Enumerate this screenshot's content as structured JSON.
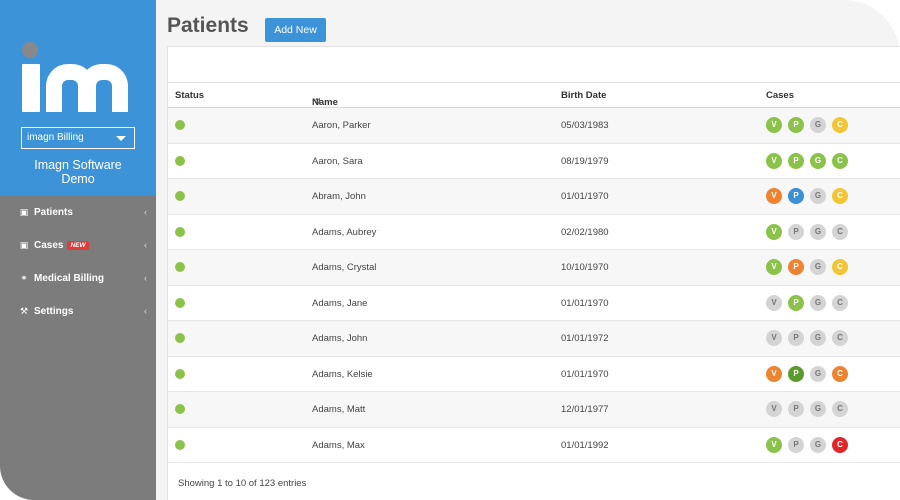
{
  "sidebar": {
    "client_select": "imagn Billing",
    "org_name_line1": "Imagn Software",
    "org_name_line2": "Demo",
    "nav": [
      {
        "label": "Patients",
        "icon": "briefcase-icon",
        "badge": ""
      },
      {
        "label": "Cases",
        "icon": "briefcase-icon",
        "badge": "NEW"
      },
      {
        "label": "Medical Billing",
        "icon": "stethoscope-icon",
        "badge": ""
      },
      {
        "label": "Settings",
        "icon": "wrench-icon",
        "badge": ""
      }
    ]
  },
  "main": {
    "title": "Patients",
    "add_label": "Add New",
    "columns": {
      "status": "Status",
      "name": "Name",
      "birth": "Birth Date",
      "cases": "Cases"
    },
    "rows": [
      {
        "name": "Aaron, Parker",
        "birth": "05/03/1983",
        "cases": [
          "green",
          "green",
          "grey",
          "yellow"
        ]
      },
      {
        "name": "Aaron, Sara",
        "birth": "08/19/1979",
        "cases": [
          "green",
          "green",
          "green",
          "green"
        ]
      },
      {
        "name": "Abram, John",
        "birth": "01/01/1970",
        "cases": [
          "orange",
          "blue",
          "grey",
          "yellow"
        ]
      },
      {
        "name": "Adams, Aubrey",
        "birth": "02/02/1980",
        "cases": [
          "green",
          "grey",
          "grey",
          "grey"
        ]
      },
      {
        "name": "Adams, Crystal",
        "birth": "10/10/1970",
        "cases": [
          "green",
          "orange",
          "grey",
          "yellow"
        ]
      },
      {
        "name": "Adams, Jane",
        "birth": "01/01/1970",
        "cases": [
          "grey",
          "green",
          "grey",
          "grey"
        ]
      },
      {
        "name": "Adams, John",
        "birth": "01/01/1972",
        "cases": [
          "grey",
          "grey",
          "grey",
          "grey"
        ]
      },
      {
        "name": "Adams, Kelsie",
        "birth": "01/01/1970",
        "cases": [
          "orange",
          "dgreen",
          "grey",
          "orange"
        ]
      },
      {
        "name": "Adams, Matt",
        "birth": "12/01/1977",
        "cases": [
          "grey",
          "grey",
          "grey",
          "grey"
        ]
      },
      {
        "name": "Adams, Max",
        "birth": "01/01/1992",
        "cases": [
          "green",
          "grey",
          "grey",
          "red"
        ]
      }
    ],
    "case_letters": [
      "V",
      "P",
      "G",
      "C"
    ],
    "footer": "Showing 1 to 10 of 123 entries"
  }
}
